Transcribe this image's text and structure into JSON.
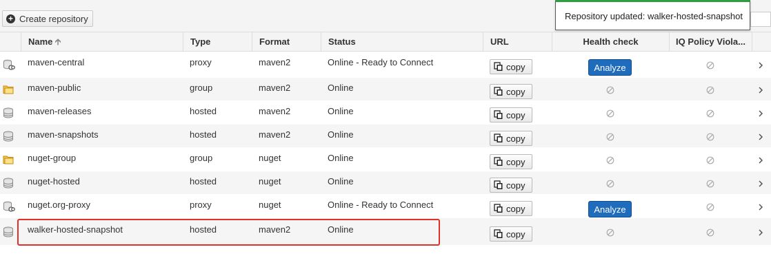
{
  "toolbar": {
    "create_label": "Create repository"
  },
  "toast": {
    "message": "Repository updated: walker-hosted-snapshot"
  },
  "columns": {
    "name": "Name",
    "type": "Type",
    "format": "Format",
    "status": "Status",
    "url": "URL",
    "health": "Health check",
    "iq": "IQ Policy Viola..."
  },
  "copy_label": "copy",
  "analyze_label": "Analyze",
  "rows": [
    {
      "name": "maven-central",
      "type": "proxy",
      "format": "maven2",
      "status": "Online - Ready to Connect",
      "icon": "proxy-repo-icon",
      "health": "analyze"
    },
    {
      "name": "maven-public",
      "type": "group",
      "format": "maven2",
      "status": "Online",
      "icon": "group-folder-icon",
      "health": "na"
    },
    {
      "name": "maven-releases",
      "type": "hosted",
      "format": "maven2",
      "status": "Online",
      "icon": "database-icon",
      "health": "na"
    },
    {
      "name": "maven-snapshots",
      "type": "hosted",
      "format": "maven2",
      "status": "Online",
      "icon": "database-icon",
      "health": "na"
    },
    {
      "name": "nuget-group",
      "type": "group",
      "format": "nuget",
      "status": "Online",
      "icon": "group-folder-icon",
      "health": "na"
    },
    {
      "name": "nuget-hosted",
      "type": "hosted",
      "format": "nuget",
      "status": "Online",
      "icon": "database-icon",
      "health": "na"
    },
    {
      "name": "nuget.org-proxy",
      "type": "proxy",
      "format": "nuget",
      "status": "Online - Ready to Connect",
      "icon": "proxy-repo-icon",
      "health": "analyze"
    },
    {
      "name": "walker-hosted-snapshot",
      "type": "hosted",
      "format": "maven2",
      "status": "Online",
      "icon": "database-icon",
      "health": "na"
    }
  ]
}
